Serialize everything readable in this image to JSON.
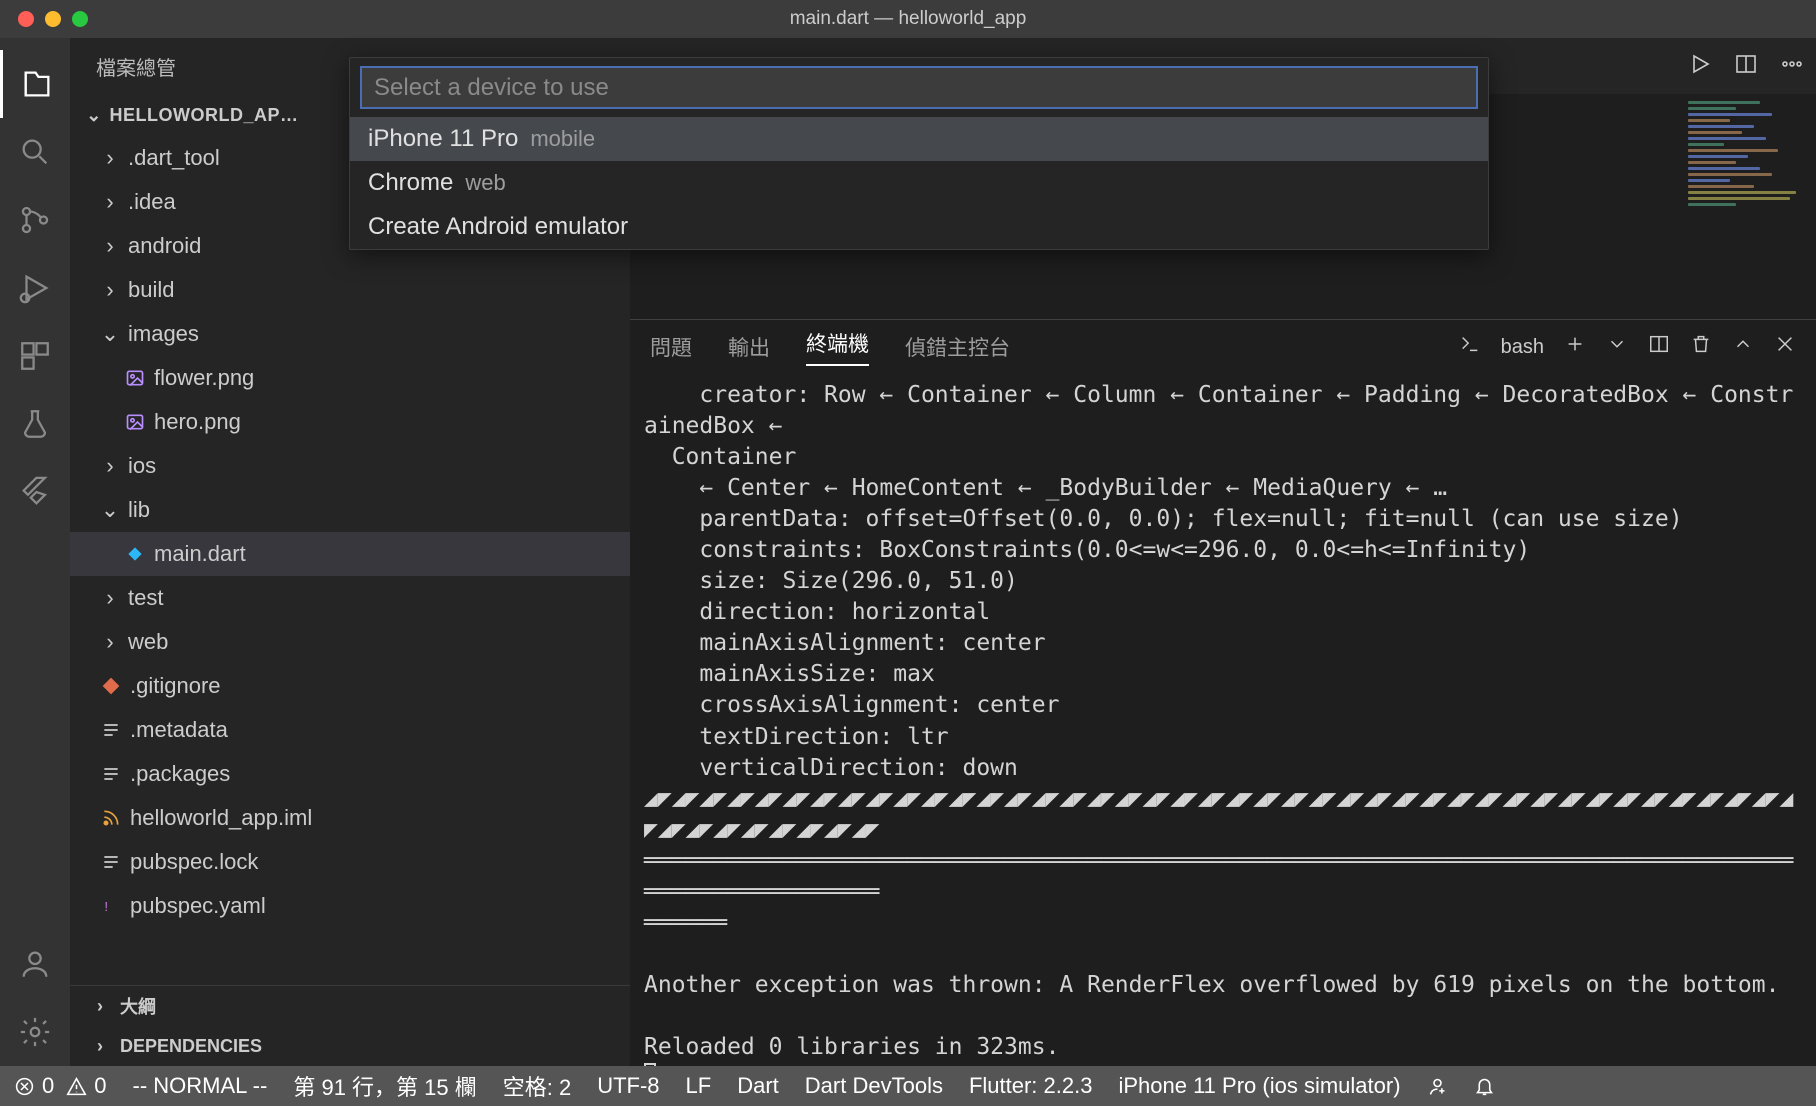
{
  "window": {
    "title": "main.dart — helloworld_app"
  },
  "sidebar": {
    "title": "檔案總管",
    "project": "HELLOWORLD_AP…",
    "tree": [
      {
        "label": ".dart_tool",
        "chev": "›"
      },
      {
        "label": ".idea",
        "chev": "›"
      },
      {
        "label": "android",
        "chev": "›"
      },
      {
        "label": "build",
        "chev": "›"
      },
      {
        "label": "images",
        "chev": "⌄"
      },
      {
        "label": "flower.png",
        "icon": "image"
      },
      {
        "label": "hero.png",
        "icon": "image"
      },
      {
        "label": "ios",
        "chev": "›"
      },
      {
        "label": "lib",
        "chev": "⌄"
      },
      {
        "label": "main.dart",
        "icon": "dart",
        "selected": true
      },
      {
        "label": "test",
        "chev": "›"
      },
      {
        "label": "web",
        "chev": "›"
      },
      {
        "label": ".gitignore",
        "icon": "git"
      },
      {
        "label": ".metadata",
        "icon": "lines"
      },
      {
        "label": ".packages",
        "icon": "lines"
      },
      {
        "label": "helloworld_app.iml",
        "icon": "rss"
      },
      {
        "label": "pubspec.lock",
        "icon": "lines"
      },
      {
        "label": "pubspec.yaml",
        "icon": "yaml"
      }
    ],
    "outline": "大綱",
    "dependencies": "DEPENDENCIES"
  },
  "quickpick": {
    "placeholder": "Select a device to use",
    "items": [
      {
        "label": "iPhone 11 Pro",
        "sub": "mobile",
        "selected": true
      },
      {
        "label": "Chrome",
        "sub": "web"
      },
      {
        "label": "Create Android emulator",
        "sub": ""
      }
    ]
  },
  "panel": {
    "tabs": {
      "problems": "問題",
      "output": "輸出",
      "terminal": "終端機",
      "debug": "偵錯主控台"
    },
    "shell": "bash"
  },
  "terminal_text": "    creator: Row ← Container ← Column ← Container ← Padding ← DecoratedBox ← ConstrainedBox ←\n  Container\n    ← Center ← HomeContent ← _BodyBuilder ← MediaQuery ← …\n    parentData: offset=Offset(0.0, 0.0); flex=null; fit=null (can use size)\n    constraints: BoxConstraints(0.0<=w<=296.0, 0.0<=h<=Infinity)\n    size: Size(296.0, 51.0)\n    direction: horizontal\n    mainAxisAlignment: center\n    mainAxisSize: max\n    crossAxisAlignment: center\n    textDirection: ltr\n    verticalDirection: down\n◢◤◢◤◢◤◢◤◢◤◢◤◢◤◢◤◢◤◢◤◢◤◢◤◢◤◢◤◢◤◢◤◢◤◢◤◢◤◢◤◢◤◢◤◢◤◢◤◢◤◢◤◢◤◢◤◢◤◢◤◢◤◢◤◢◤◢◤◢◤◢◤◢◤◢◤◢◤◢◤◢◤◢◤◢◤◢◤◢◤◢◤◢◤◢◤◢◤◢◤\n════════════════════════════════════════════════════════════════════════════════════════════════════\n══════\n\nAnother exception was thrown: A RenderFlex overflowed by 619 pixels on the bottom.\n\nReloaded 0 libraries in 323ms.",
  "statusbar": {
    "errors": "0",
    "warnings": "0",
    "mode": "-- NORMAL --",
    "position": "第 91 行，第 15 欄",
    "spaces": "空格: 2",
    "encoding": "UTF-8",
    "eol": "LF",
    "lang": "Dart",
    "devtools": "Dart DevTools",
    "flutter": "Flutter: 2.2.3",
    "device": "iPhone 11 Pro (ios simulator)"
  }
}
